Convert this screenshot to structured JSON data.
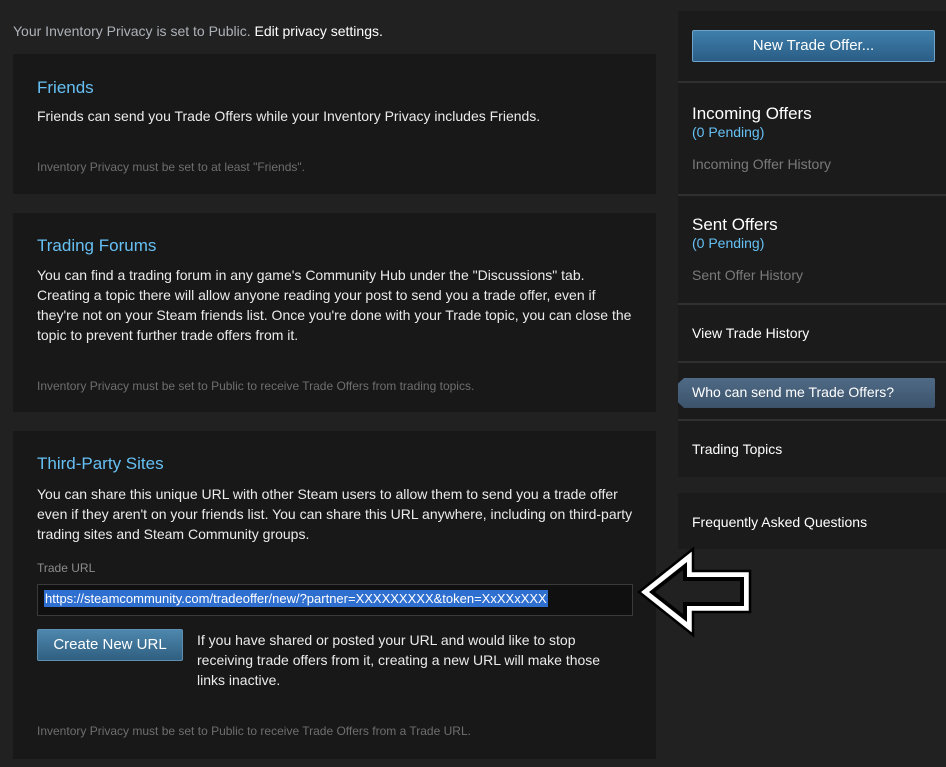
{
  "privacy_note": {
    "prefix": "Your Inventory Privacy is set to Public. ",
    "link": "Edit privacy settings."
  },
  "friends": {
    "title": "Friends",
    "body": "Friends can send you Trade Offers while your Inventory Privacy includes Friends.",
    "footnote": "Inventory Privacy must be set to at least \"Friends\"."
  },
  "forums": {
    "title": "Trading Forums",
    "body": "You can find a trading forum in any game's Community Hub under the \"Discussions\" tab. Creating a topic there will allow anyone reading your post to send you a trade offer, even if they're not on your Steam friends list. Once you're done with your Trade topic, you can close the topic to prevent further trade offers from it.",
    "footnote": "Inventory Privacy must be set to Public to receive Trade Offers from trading topics."
  },
  "third_party": {
    "title": "Third-Party Sites",
    "body": "You can share this unique URL with other Steam users to allow them to send you a trade offer even if they aren't on your friends list. You can share this URL anywhere, including on third-party trading sites and Steam Community groups.",
    "url_label": "Trade URL",
    "url_value": "https://steamcommunity.com/tradeoffer/new/?partner=XXXXXXXXX&token=XxXXxXXX",
    "create_button": "Create New URL",
    "create_note": "If you have shared or posted your URL and would like to stop receiving trade offers from it, creating a new URL will make those links inactive.",
    "footnote": "Inventory Privacy must be set to Public to receive Trade Offers from a Trade URL."
  },
  "sidebar": {
    "new_offer_button": "New Trade Offer...",
    "incoming": {
      "title": "Incoming Offers",
      "pending": "(0 Pending)",
      "history": "Incoming Offer History"
    },
    "sent": {
      "title": "Sent Offers",
      "pending": "(0 Pending)",
      "history": "Sent Offer History"
    },
    "view_history": "View Trade History",
    "active_item": "Who can send me Trade Offers?",
    "trading_topics": "Trading Topics",
    "faq": "Frequently Asked Questions"
  },
  "colors": {
    "accent_blue": "#66c0f4",
    "background": "#212121",
    "panel": "#181818",
    "selection": "#2f6fd0"
  },
  "icons": {
    "annotation": "left-arrow-outline-icon"
  }
}
